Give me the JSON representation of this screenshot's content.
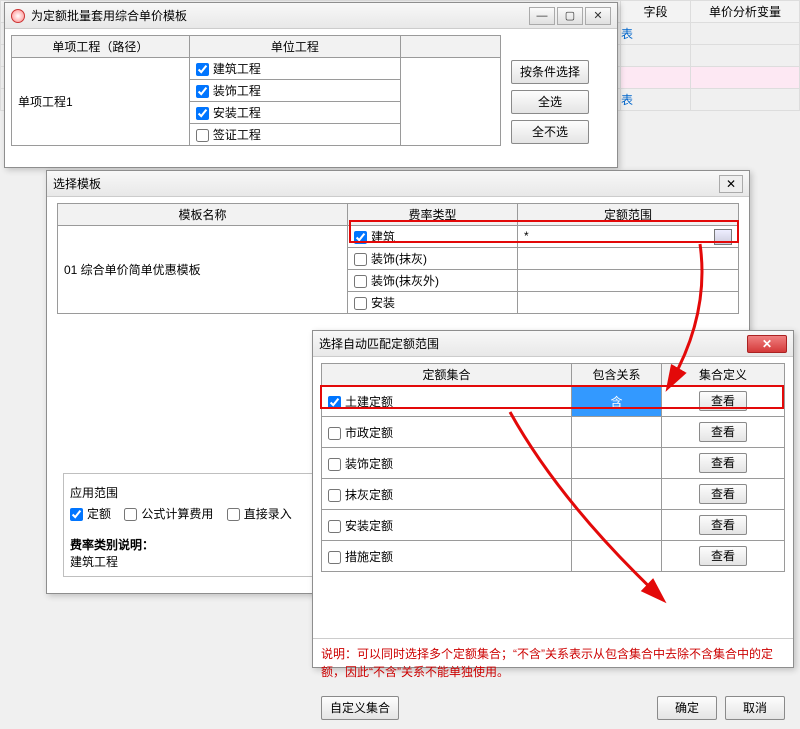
{
  "bg": {
    "col1": "字段",
    "col2": "单价分析变量",
    "linkchar": "表"
  },
  "win1": {
    "title": "为定额批量套用综合单价模板",
    "hdr_project": "单项工程（路径）",
    "hdr_unit": "单位工程",
    "project_name": "单项工程1",
    "units": [
      "建筑工程",
      "装饰工程",
      "安装工程",
      "签证工程"
    ],
    "btn_filter": "按条件选择",
    "btn_all": "全选",
    "btn_none": "全不选"
  },
  "win2": {
    "title": "选择模板",
    "hdr_tpl": "模板名称",
    "hdr_rate": "费率类型",
    "hdr_scope": "定额范围",
    "tpl_name": "01 综合单价简单优惠模板",
    "rates": [
      "建筑",
      "装饰(抹灰)",
      "装饰(抹灰外)",
      "安装"
    ],
    "scope_star": "*",
    "section_scope_title": "应用范围",
    "chk_quota": "定额",
    "chk_formula": "公式计算费用",
    "chk_direct": "直接录入",
    "desc_label": "费率类别说明：",
    "desc_value": "建筑工程"
  },
  "win3": {
    "title": "选择自动匹配定额范围",
    "hdr_set": "定额集合",
    "hdr_rel": "包含关系",
    "hdr_def": "集合定义",
    "rows": [
      {
        "name": "土建定额",
        "rel": "含",
        "checked": true
      },
      {
        "name": "市政定额",
        "rel": "",
        "checked": false
      },
      {
        "name": "装饰定额",
        "rel": "",
        "checked": false
      },
      {
        "name": "抹灰定额",
        "rel": "",
        "checked": false
      },
      {
        "name": "安装定额",
        "rel": "",
        "checked": false
      },
      {
        "name": "措施定额",
        "rel": "",
        "checked": false
      }
    ],
    "btn_view": "查看",
    "note": "说明：可以同时选择多个定额集合；“不含”关系表示从包含集合中去除不含集合中的定额，因此“不含”关系不能单独使用。",
    "btn_custom": "自定义集合",
    "btn_ok": "确定",
    "btn_cancel": "取消"
  }
}
